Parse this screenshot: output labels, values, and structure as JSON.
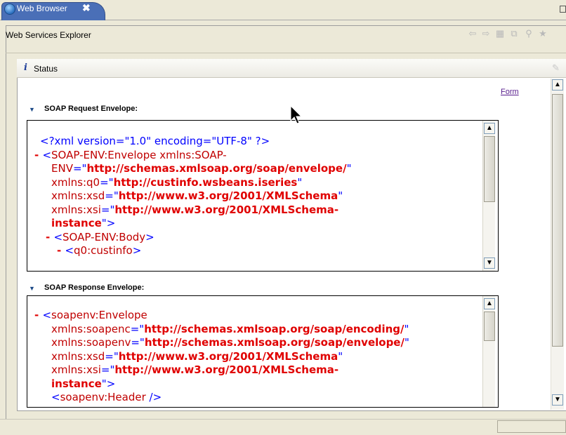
{
  "tab": {
    "label": "Web Browser",
    "close_glyph": "✖"
  },
  "explorer": {
    "title": "Web Services Explorer",
    "toolbar_icons": [
      "back-icon",
      "forward-icon",
      "page-icon",
      "copy-icon",
      "search-icon",
      "favorite-icon"
    ]
  },
  "status_panel": {
    "title": "Status",
    "form_link": "Form"
  },
  "request": {
    "title": "SOAP Request Envelope:",
    "lines": [
      {
        "minus": "",
        "indent": 0,
        "parts": [
          {
            "c": "pi",
            "t": "<?xml version=\"1.0\" encoding=\"UTF-8\" ?>"
          }
        ]
      },
      {
        "minus": "- ",
        "indent": 0,
        "parts": [
          {
            "c": "bl",
            "t": "<"
          },
          {
            "c": "tag",
            "t": "SOAP-ENV:Envelope xmlns:SOAP-"
          }
        ]
      },
      {
        "minus": "",
        "indent": 1,
        "parts": [
          {
            "c": "tag",
            "t": "ENV"
          },
          {
            "c": "bl",
            "t": "=\""
          },
          {
            "c": "val",
            "t": "http://schemas.xmlsoap.org/soap/envelope/"
          },
          {
            "c": "bl",
            "t": "\""
          }
        ]
      },
      {
        "minus": "",
        "indent": 1,
        "parts": [
          {
            "c": "tag",
            "t": "xmlns:q0"
          },
          {
            "c": "bl",
            "t": "=\""
          },
          {
            "c": "val",
            "t": "http://custinfo.wsbeans.iseries"
          },
          {
            "c": "bl",
            "t": "\""
          }
        ]
      },
      {
        "minus": "",
        "indent": 1,
        "parts": [
          {
            "c": "tag",
            "t": "xmlns:xsd"
          },
          {
            "c": "bl",
            "t": "=\""
          },
          {
            "c": "val",
            "t": "http://www.w3.org/2001/XMLSchema"
          },
          {
            "c": "bl",
            "t": "\""
          }
        ]
      },
      {
        "minus": "",
        "indent": 1,
        "parts": [
          {
            "c": "tag",
            "t": "xmlns:xsi"
          },
          {
            "c": "bl",
            "t": "=\""
          },
          {
            "c": "val",
            "t": "http://www.w3.org/2001/XMLSchema-"
          }
        ]
      },
      {
        "minus": "",
        "indent": 1,
        "parts": [
          {
            "c": "val",
            "t": "instance"
          },
          {
            "c": "bl",
            "t": "\">"
          }
        ]
      },
      {
        "minus": "- ",
        "indent": 1,
        "parts": [
          {
            "c": "bl",
            "t": "<"
          },
          {
            "c": "tag",
            "t": "SOAP-ENV:Body"
          },
          {
            "c": "bl",
            "t": ">"
          }
        ]
      },
      {
        "minus": "- ",
        "indent": 2,
        "parts": [
          {
            "c": "bl",
            "t": "<"
          },
          {
            "c": "tag",
            "t": "q0:custinfo"
          },
          {
            "c": "bl",
            "t": ">"
          }
        ]
      }
    ]
  },
  "response": {
    "title": "SOAP Response Envelope:",
    "lines": [
      {
        "minus": "- ",
        "indent": 0,
        "parts": [
          {
            "c": "bl",
            "t": "<"
          },
          {
            "c": "tag",
            "t": "soapenv:Envelope"
          }
        ]
      },
      {
        "minus": "",
        "indent": 1,
        "parts": [
          {
            "c": "tag",
            "t": "xmlns:soapenc"
          },
          {
            "c": "bl",
            "t": "=\""
          },
          {
            "c": "val",
            "t": "http://schemas.xmlsoap.org/soap/encoding/"
          },
          {
            "c": "bl",
            "t": "\""
          }
        ]
      },
      {
        "minus": "",
        "indent": 1,
        "parts": [
          {
            "c": "tag",
            "t": "xmlns:soapenv"
          },
          {
            "c": "bl",
            "t": "=\""
          },
          {
            "c": "val",
            "t": "http://schemas.xmlsoap.org/soap/envelope/"
          },
          {
            "c": "bl",
            "t": "\""
          }
        ]
      },
      {
        "minus": "",
        "indent": 1,
        "parts": [
          {
            "c": "tag",
            "t": "xmlns:xsd"
          },
          {
            "c": "bl",
            "t": "=\""
          },
          {
            "c": "val",
            "t": "http://www.w3.org/2001/XMLSchema"
          },
          {
            "c": "bl",
            "t": "\""
          }
        ]
      },
      {
        "minus": "",
        "indent": 1,
        "parts": [
          {
            "c": "tag",
            "t": "xmlns:xsi"
          },
          {
            "c": "bl",
            "t": "=\""
          },
          {
            "c": "val",
            "t": "http://www.w3.org/2001/XMLSchema-"
          }
        ]
      },
      {
        "minus": "",
        "indent": 1,
        "parts": [
          {
            "c": "val",
            "t": "instance"
          },
          {
            "c": "bl",
            "t": "\">"
          }
        ]
      },
      {
        "minus": "",
        "indent": 1,
        "parts": [
          {
            "c": "bl",
            "t": "<"
          },
          {
            "c": "tag",
            "t": "soapenv:Header"
          },
          {
            "c": "bl",
            "t": " />"
          }
        ]
      }
    ]
  },
  "colors": {
    "tab_blue": "#4a6fb7",
    "tag": "#c00000",
    "value": "#e00000",
    "markup": "#0000ff"
  }
}
